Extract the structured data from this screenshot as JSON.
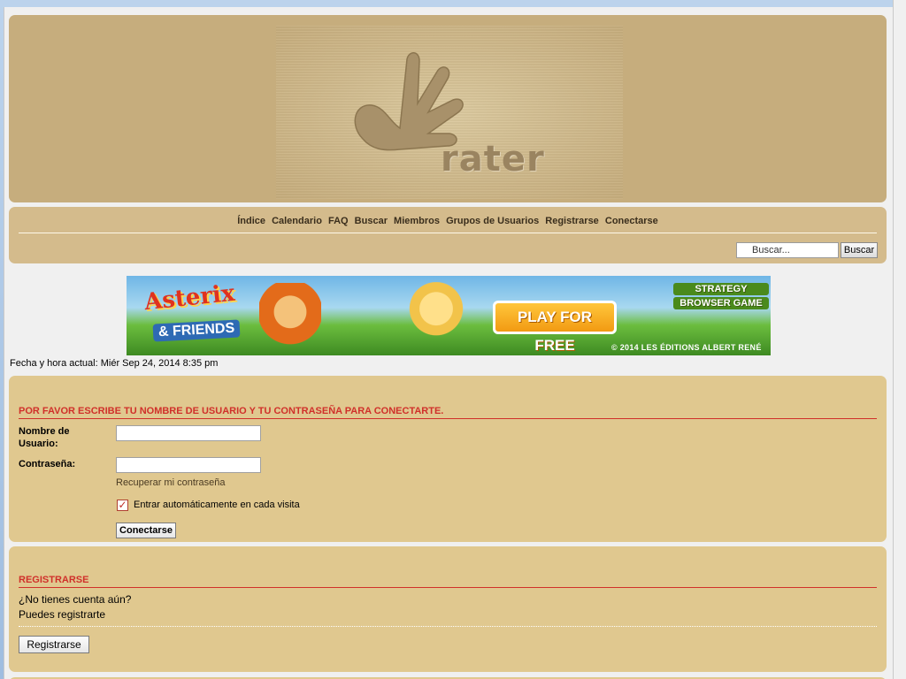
{
  "header": {
    "logo_text": "rater",
    "logo_icon": "hand-logo-icon"
  },
  "nav": {
    "items": [
      "Índice",
      "Calendario",
      "FAQ",
      "Buscar",
      "Miembros",
      "Grupos de Usuarios",
      "Registrarse",
      "Conectarse"
    ]
  },
  "search": {
    "placeholder": "Buscar...",
    "button_label": "Buscar",
    "icon": "search-icon"
  },
  "ad": {
    "logo": "Asterix",
    "subtitle": "& FRIENDS",
    "cta": "PLAY FOR FREE",
    "tagline_line1": "STRATEGY",
    "tagline_line2": "BROWSER GAME",
    "copyright": "© 2014 LES ÉDITIONS ALBERT RENÉ"
  },
  "datetime": "Fecha y hora actual: Miér Sep 24, 2014 8:35 pm",
  "login": {
    "title": "POR FAVOR ESCRIBE TU NOMBRE DE USUARIO Y TU CONTRASEÑA PARA CONECTARTE.",
    "username_label_line1": "Nombre de",
    "username_label_line2": "Usuario:",
    "username_value": "",
    "password_label": "Contraseña:",
    "password_value": "",
    "recover_link": "Recuperar mi contraseña",
    "autologin_label": "Entrar automáticamente en cada visita",
    "autologin_checked": true,
    "submit_label": "Conectarse"
  },
  "register": {
    "title": "REGISTRARSE",
    "line1": "¿No tienes cuenta aún?",
    "line2": "Puedes registrarte",
    "button_label": "Registrarse"
  },
  "colors": {
    "header_bg": "#c6ad7d",
    "panel_bg": "#e0c88f",
    "title_red": "#d0302a"
  }
}
